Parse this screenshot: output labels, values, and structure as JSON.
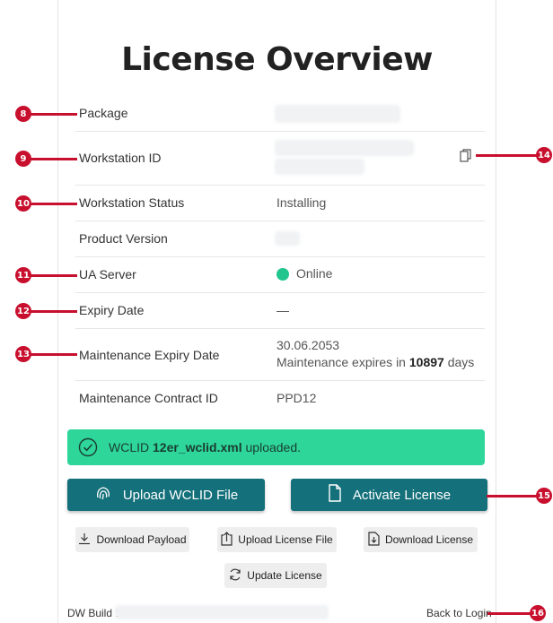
{
  "page": {
    "title": "License Overview"
  },
  "rows": [
    {
      "label": "Package",
      "value": ""
    },
    {
      "label": "Workstation ID",
      "value": ""
    },
    {
      "label": "Workstation Status",
      "value": "Installing"
    },
    {
      "label": "Product Version",
      "value": ""
    },
    {
      "label": "UA Server",
      "value": "Online"
    },
    {
      "label": "Expiry Date",
      "value": "—"
    },
    {
      "label": "Maintenance Expiry Date",
      "value": "30.06.2053",
      "note_prefix": "Maintenance expires in ",
      "note_days": "10897",
      "note_suffix": " days"
    },
    {
      "label": "Maintenance Contract ID",
      "value": "PPD12"
    }
  ],
  "alert": {
    "prefix": "WCLID ",
    "filename": "12er_wclid.xml",
    "suffix": " uploaded.",
    "color": "#2ed69a"
  },
  "buttons": {
    "upload_wclid": "Upload WCLID File",
    "activate": "Activate License",
    "download_payload": "Download Payload",
    "upload_license": "Upload License File",
    "download_license": "Download License",
    "update_license": "Update License"
  },
  "footer": {
    "build_prefix": "DW Build 1.",
    "back_to_login": "Back to Login"
  },
  "callouts": [
    "8",
    "9",
    "10",
    "11",
    "12",
    "13",
    "14",
    "15",
    "16"
  ],
  "colors": {
    "primary": "#14707a",
    "online": "#22c58e",
    "callout": "#c8102e"
  }
}
